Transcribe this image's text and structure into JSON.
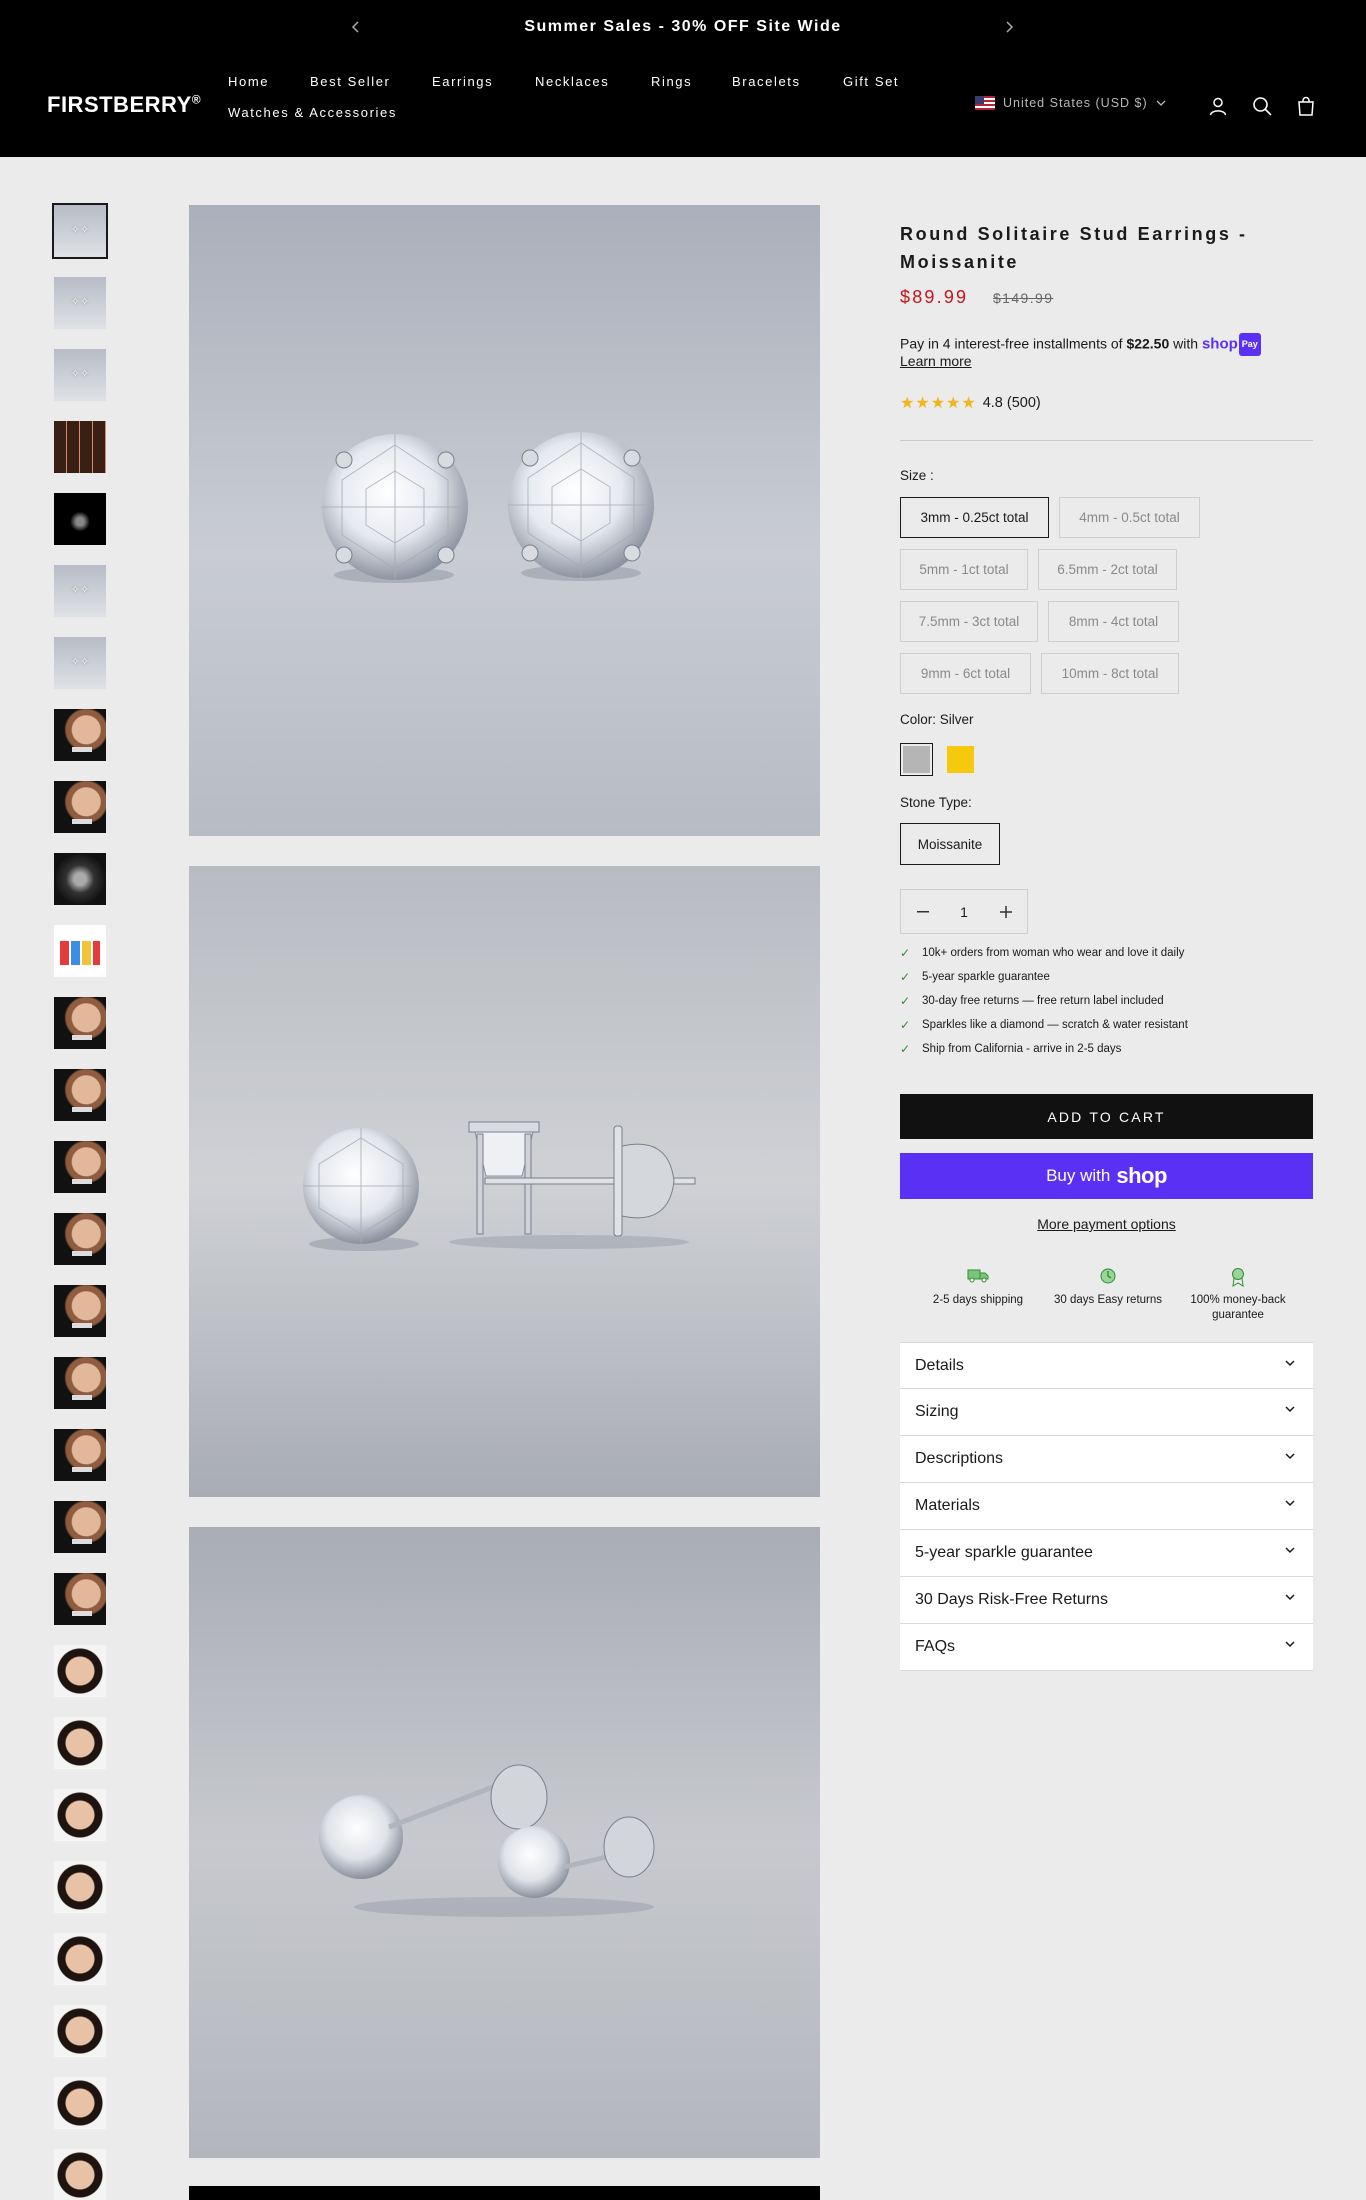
{
  "announcement": {
    "message": "Summer Sales - 30% OFF Site Wide"
  },
  "header": {
    "logo": "FIRSTBERRY",
    "logo_mark": "®",
    "nav": [
      "Home",
      "Best Seller",
      "Earrings",
      "Necklaces",
      "Rings",
      "Bracelets",
      "Gift Set",
      "Watches & Accessories"
    ],
    "region": "United States (USD $)"
  },
  "gallery": {
    "thumbnails": [
      "studs",
      "studs",
      "studs",
      "grid",
      "dark",
      "studs",
      "studs",
      "ear",
      "ear",
      "multi",
      "info",
      "ear",
      "ear",
      "ear",
      "ear",
      "ear",
      "ear",
      "ear",
      "ear",
      "ear",
      "face",
      "face",
      "face",
      "face",
      "face",
      "face",
      "face",
      "face"
    ]
  },
  "product": {
    "title": "Round Solitaire Stud Earrings - Moissanite",
    "price": "$89.99",
    "compare_price": "$149.99",
    "installments_prefix": "Pay in 4 interest-free installments of ",
    "installments_amount": "$22.50",
    "installments_suffix": " with ",
    "shop_pay": "shop",
    "shop_pay_badge": "Pay",
    "learn_more": "Learn more",
    "stars": "★★★★★",
    "rating": "4.8 (500)",
    "size_label": "Size :",
    "sizes": [
      "3mm - 0.25ct total",
      "4mm - 0.5ct total",
      "5mm - 1ct total",
      "6.5mm - 2ct total",
      "7.5mm - 3ct total",
      "8mm - 4ct total",
      "9mm - 6ct total",
      "10mm - 8ct total"
    ],
    "color_label": "Color: Silver",
    "colors": [
      {
        "name": "Silver",
        "hex": "#b5b5b5"
      },
      {
        "name": "Gold",
        "hex": "#f6c90e"
      }
    ],
    "stone_label": "Stone Type:",
    "stone": "Moissanite",
    "quantity": "1",
    "benefits": [
      "10k+ orders from woman who wear and love it daily",
      "5-year sparkle guarantee",
      "30-day free returns — free return label included",
      "Sparkles like a diamond — scratch & water resistant",
      "Ship from California - arrive in 2-5 days"
    ],
    "add_to_cart": "ADD TO CART",
    "buy_with": "Buy with",
    "buy_shop": "shop",
    "more_payment": "More payment options",
    "perks": [
      "2-5 days shipping",
      "30 days Easy returns",
      "100% money-back guarantee"
    ],
    "accordion": [
      "Details",
      "Sizing",
      "Descriptions",
      "Materials",
      "5-year sparkle guarantee",
      "30 Days Risk-Free Returns",
      "FAQs"
    ]
  },
  "colors": {
    "sale": "#c4161c",
    "shop_pay": "#5a31f4",
    "check": "#2f8f2f",
    "star": "#f3b51b"
  }
}
